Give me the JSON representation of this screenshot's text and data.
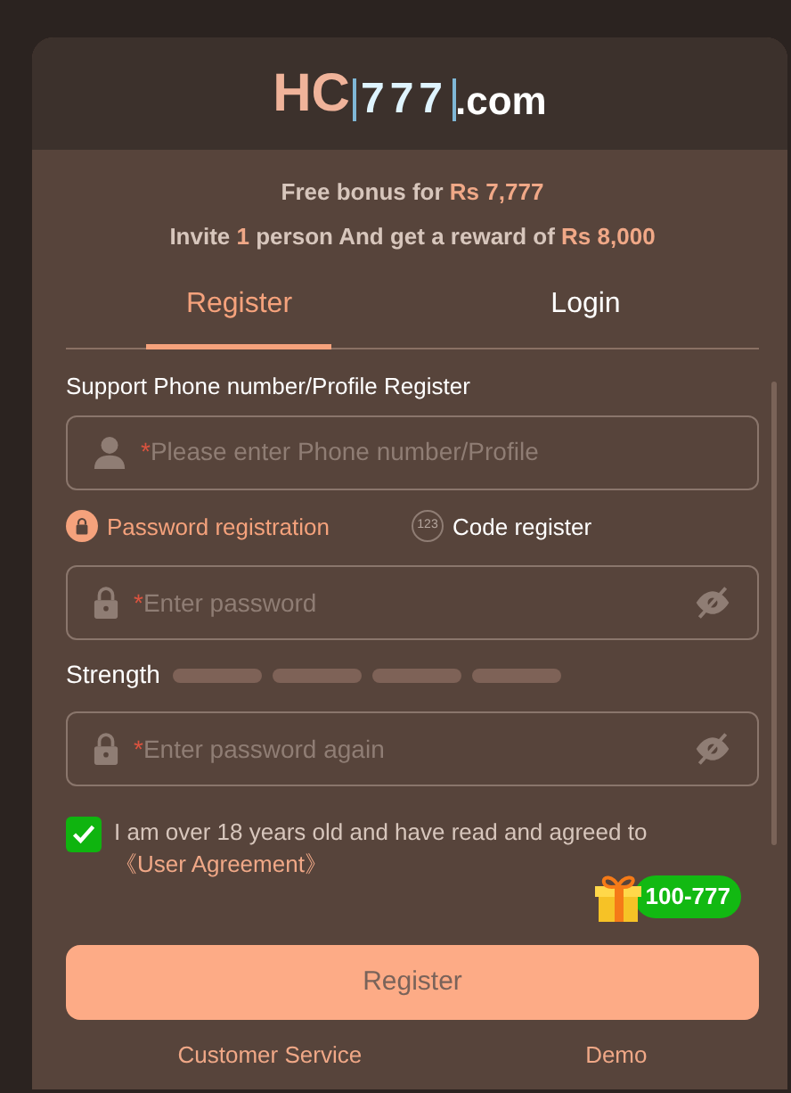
{
  "logo": {
    "brand": "HC",
    "number": "777",
    "suffix": ".com"
  },
  "bonus_lines": [
    "Free bonus for **Rs 7,777**",
    "Invite **1** person And get a reward of **Rs 8,000**"
  ],
  "tabs": [
    {
      "label": "Register",
      "selected": true
    },
    {
      "label": "Login",
      "selected": false
    }
  ],
  "section_label": "Support Phone number/Profile Register",
  "phone_field": {
    "kind": "phone",
    "marker": "*",
    "placeholder": "Please enter Phone number/Profile"
  },
  "register_methods": [
    {
      "kind": "password",
      "label": "Password registration",
      "selected": true
    },
    {
      "kind": "code",
      "label": "Code register",
      "icon_text": "123",
      "selected": false
    }
  ],
  "password_field": {
    "kind": "password",
    "marker": "*",
    "placeholder": "Enter password"
  },
  "strength": {
    "label": "Strength"
  },
  "confirm_field": {
    "kind": "password",
    "marker": "*",
    "placeholder": "Enter password again"
  },
  "agreement": {
    "checked": true,
    "text": "I am over 18 years old and have read and agreed to ",
    "link": "《User Agreement》"
  },
  "gift_badge": "100-777",
  "register_button": "Register",
  "footer_links": [
    "Customer Service",
    "Demo"
  ]
}
